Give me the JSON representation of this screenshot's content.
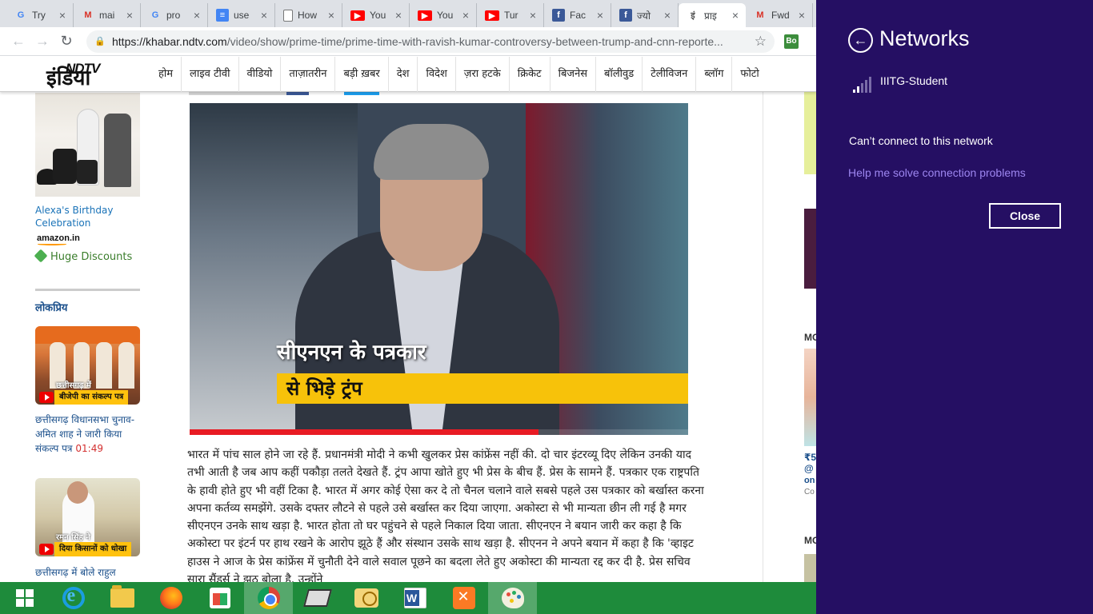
{
  "browser": {
    "tabs": [
      {
        "favicon": "google-g-icon",
        "glyph": "G",
        "title": "Try",
        "active": false
      },
      {
        "favicon": "gmail-icon",
        "glyph": "M",
        "title": "mai",
        "active": false
      },
      {
        "favicon": "google-g-icon",
        "glyph": "G",
        "title": "pro",
        "active": false
      },
      {
        "favicon": "google-docs-icon",
        "glyph": "≡",
        "title": "use",
        "active": false
      },
      {
        "favicon": "document-icon",
        "glyph": "",
        "title": "How",
        "active": false
      },
      {
        "favicon": "youtube-icon",
        "glyph": "▶",
        "title": "You",
        "active": false
      },
      {
        "favicon": "youtube-icon",
        "glyph": "▶",
        "title": "You",
        "active": false
      },
      {
        "favicon": "youtube-icon",
        "glyph": "▶",
        "title": "Tur",
        "active": false
      },
      {
        "favicon": "facebook-icon",
        "glyph": "f",
        "title": "Fac",
        "active": false
      },
      {
        "favicon": "facebook-icon",
        "glyph": "f",
        "title": "ज्यो",
        "active": false
      },
      {
        "favicon": "ndtv-icon",
        "glyph": "इं",
        "title": "प्राइ",
        "active": true
      },
      {
        "favicon": "gmail-icon",
        "glyph": "M",
        "title": "Fwd",
        "active": false
      }
    ],
    "url_host": "https://khabar.ndtv.com",
    "url_path": "/video/show/prime-time/prime-time-with-ravish-kumar-controversy-between-trump-and-cnn-reporte...",
    "extension_label": "Bo"
  },
  "site": {
    "logo_top": "NDTV",
    "logo_bottom": "इंडिया",
    "nav": [
      "होम",
      "लाइव टीवी",
      "वीडियो",
      "ताज़ातरीन",
      "बड़ी ख़बर",
      "देश",
      "विदेश",
      "ज़रा हटके",
      "क्रिकेट",
      "बिजनेस",
      "बॉलीवुड",
      "टेलीविजन",
      "ब्लॉग",
      "फोटो"
    ]
  },
  "sidebar": {
    "ad_title": "Alexa's Birthday Celebration",
    "ad_brand": "amazon.in",
    "ad_offer": "Huge Discounts",
    "section_title": "लोकप्रिय",
    "items": [
      {
        "thumb_caption_top": "छत्तीसगढ़ में",
        "thumb_caption_bottom": "बीजेपी का संकल्प पत्र",
        "headline": "छत्तीसगढ़ विधानसभा चुनाव- अमित शाह ने जारी किया संकल्प पत्र",
        "duration": "01:49"
      },
      {
        "thumb_caption_top": "रमन सिंह ने",
        "thumb_caption_bottom": "दिया किसानों को धोखा",
        "headline": "छत्तीसगढ़ में बोले राहुल",
        "duration": ""
      }
    ]
  },
  "video": {
    "caption_top": "सीएनएन के पत्रकार",
    "caption_bottom": "से भिड़े ट्रंप",
    "progress": 0.7
  },
  "article": {
    "text": "भारत में पांच साल होने जा रहे हैं. प्रधानमंत्री मोदी ने कभी खुलकर प्रेस कांफ्रेंस नहीं की. दो चार इंटरव्यू दिए लेकिन उनकी याद तभी आती है जब आप कहीं पकौड़ा तलते देखते हैं. ट्रंप आपा खोते हुए भी प्रेस के बीच हैं. प्रेस के सामने हैं. पत्रकार एक राष्ट्रपति के हावी होते हुए भी वहीं टिका है. भारत में अगर कोई ऐसा कर दे तो चैनल चलाने वाले सबसे पहले उस पत्रकार को बर्खास्त करना अपना कर्तव्य समझेंगे. उसके दफ्तर लौटने से पहले उसे बर्खास्त कर दिया जाएगा. अकोस्टा से भी मान्यता छीन ली गई है मगर सीएनएन उनके साथ खड़ा है. भारत होता तो घर पहुंचने से पहले निकाल दिया जाता. सीएनएन ने बयान जारी कर कहा है कि अकोस्टा पर इंटर्न पर हाथ रखने के आरोप झूठे हैं और संस्थान उसके साथ खड़ा है. सीएनन ने अपने बयान में कहा है कि 'व्हाइट हाउस ने आज के प्रेस कांफ्रेंस में चुनौती देने वाले सवाल पूछने का बदला लेते हुए अकोस्टा की मान्यता रद्द कर दी है. प्रेस सचिव सारा सैंडर्स ने झूठ बोला है. उन्होंने"
  },
  "right_rail": {
    "label_1": "MO",
    "price": "₹5",
    "at": "@",
    "on": "on",
    "co": "Co",
    "label_2": "MO"
  },
  "taskbar": {
    "items": [
      "start-button",
      "internet-explorer-icon",
      "file-explorer-icon",
      "firefox-icon",
      "windows-store-icon",
      "chrome-icon",
      "scanner-icon",
      "mail-app-icon",
      "word-icon",
      "xampp-icon",
      "paint-icon"
    ],
    "active": [
      "chrome-icon",
      "paint-icon"
    ]
  },
  "networks": {
    "title": "Networks",
    "ssid": "IIITG-Student",
    "signal_bars": 5,
    "signal_active_bars": 2,
    "message": "Can’t connect to this network",
    "help_link": "Help me solve connection problems",
    "close_label": "Close",
    "bg_color": "#250f63",
    "link_color": "#9d86f0"
  }
}
